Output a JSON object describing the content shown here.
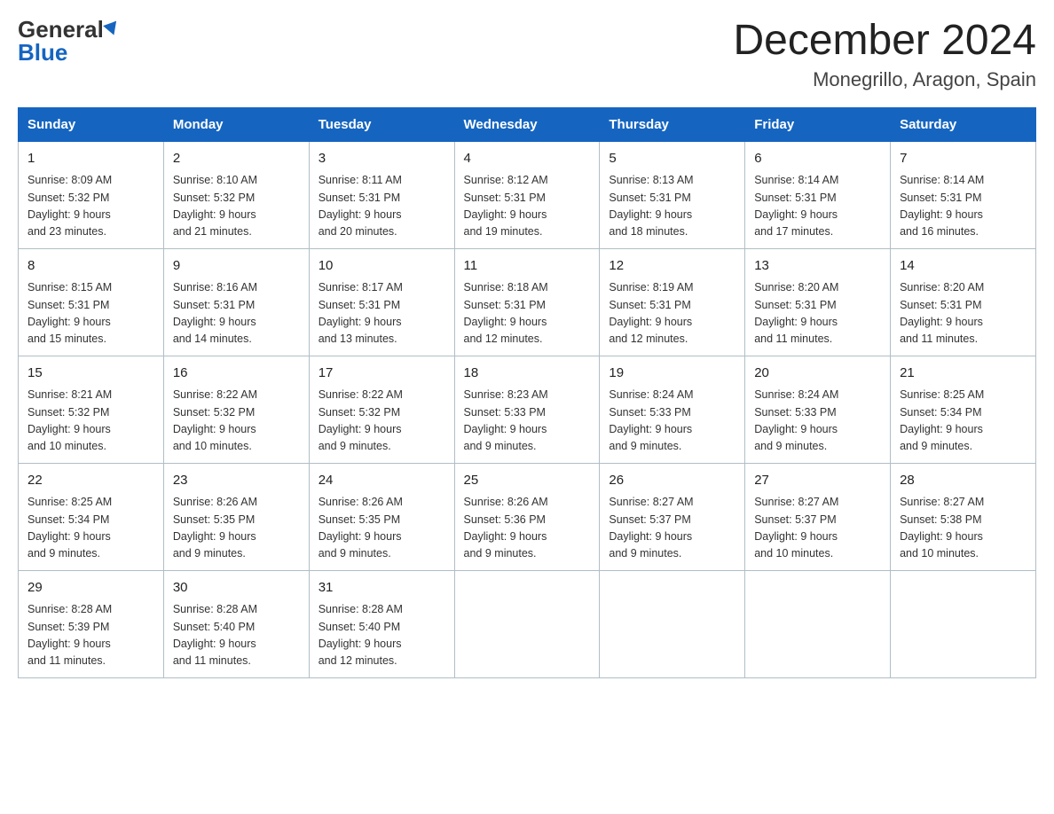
{
  "header": {
    "logo_general": "General",
    "logo_blue": "Blue",
    "title": "December 2024",
    "subtitle": "Monegrillo, Aragon, Spain"
  },
  "days_of_week": [
    "Sunday",
    "Monday",
    "Tuesday",
    "Wednesday",
    "Thursday",
    "Friday",
    "Saturday"
  ],
  "weeks": [
    [
      {
        "day": "1",
        "sunrise": "8:09 AM",
        "sunset": "5:32 PM",
        "daylight": "9 hours and 23 minutes."
      },
      {
        "day": "2",
        "sunrise": "8:10 AM",
        "sunset": "5:32 PM",
        "daylight": "9 hours and 21 minutes."
      },
      {
        "day": "3",
        "sunrise": "8:11 AM",
        "sunset": "5:31 PM",
        "daylight": "9 hours and 20 minutes."
      },
      {
        "day": "4",
        "sunrise": "8:12 AM",
        "sunset": "5:31 PM",
        "daylight": "9 hours and 19 minutes."
      },
      {
        "day": "5",
        "sunrise": "8:13 AM",
        "sunset": "5:31 PM",
        "daylight": "9 hours and 18 minutes."
      },
      {
        "day": "6",
        "sunrise": "8:14 AM",
        "sunset": "5:31 PM",
        "daylight": "9 hours and 17 minutes."
      },
      {
        "day": "7",
        "sunrise": "8:14 AM",
        "sunset": "5:31 PM",
        "daylight": "9 hours and 16 minutes."
      }
    ],
    [
      {
        "day": "8",
        "sunrise": "8:15 AM",
        "sunset": "5:31 PM",
        "daylight": "9 hours and 15 minutes."
      },
      {
        "day": "9",
        "sunrise": "8:16 AM",
        "sunset": "5:31 PM",
        "daylight": "9 hours and 14 minutes."
      },
      {
        "day": "10",
        "sunrise": "8:17 AM",
        "sunset": "5:31 PM",
        "daylight": "9 hours and 13 minutes."
      },
      {
        "day": "11",
        "sunrise": "8:18 AM",
        "sunset": "5:31 PM",
        "daylight": "9 hours and 12 minutes."
      },
      {
        "day": "12",
        "sunrise": "8:19 AM",
        "sunset": "5:31 PM",
        "daylight": "9 hours and 12 minutes."
      },
      {
        "day": "13",
        "sunrise": "8:20 AM",
        "sunset": "5:31 PM",
        "daylight": "9 hours and 11 minutes."
      },
      {
        "day": "14",
        "sunrise": "8:20 AM",
        "sunset": "5:31 PM",
        "daylight": "9 hours and 11 minutes."
      }
    ],
    [
      {
        "day": "15",
        "sunrise": "8:21 AM",
        "sunset": "5:32 PM",
        "daylight": "9 hours and 10 minutes."
      },
      {
        "day": "16",
        "sunrise": "8:22 AM",
        "sunset": "5:32 PM",
        "daylight": "9 hours and 10 minutes."
      },
      {
        "day": "17",
        "sunrise": "8:22 AM",
        "sunset": "5:32 PM",
        "daylight": "9 hours and 9 minutes."
      },
      {
        "day": "18",
        "sunrise": "8:23 AM",
        "sunset": "5:33 PM",
        "daylight": "9 hours and 9 minutes."
      },
      {
        "day": "19",
        "sunrise": "8:24 AM",
        "sunset": "5:33 PM",
        "daylight": "9 hours and 9 minutes."
      },
      {
        "day": "20",
        "sunrise": "8:24 AM",
        "sunset": "5:33 PM",
        "daylight": "9 hours and 9 minutes."
      },
      {
        "day": "21",
        "sunrise": "8:25 AM",
        "sunset": "5:34 PM",
        "daylight": "9 hours and 9 minutes."
      }
    ],
    [
      {
        "day": "22",
        "sunrise": "8:25 AM",
        "sunset": "5:34 PM",
        "daylight": "9 hours and 9 minutes."
      },
      {
        "day": "23",
        "sunrise": "8:26 AM",
        "sunset": "5:35 PM",
        "daylight": "9 hours and 9 minutes."
      },
      {
        "day": "24",
        "sunrise": "8:26 AM",
        "sunset": "5:35 PM",
        "daylight": "9 hours and 9 minutes."
      },
      {
        "day": "25",
        "sunrise": "8:26 AM",
        "sunset": "5:36 PM",
        "daylight": "9 hours and 9 minutes."
      },
      {
        "day": "26",
        "sunrise": "8:27 AM",
        "sunset": "5:37 PM",
        "daylight": "9 hours and 9 minutes."
      },
      {
        "day": "27",
        "sunrise": "8:27 AM",
        "sunset": "5:37 PM",
        "daylight": "9 hours and 10 minutes."
      },
      {
        "day": "28",
        "sunrise": "8:27 AM",
        "sunset": "5:38 PM",
        "daylight": "9 hours and 10 minutes."
      }
    ],
    [
      {
        "day": "29",
        "sunrise": "8:28 AM",
        "sunset": "5:39 PM",
        "daylight": "9 hours and 11 minutes."
      },
      {
        "day": "30",
        "sunrise": "8:28 AM",
        "sunset": "5:40 PM",
        "daylight": "9 hours and 11 minutes."
      },
      {
        "day": "31",
        "sunrise": "8:28 AM",
        "sunset": "5:40 PM",
        "daylight": "9 hours and 12 minutes."
      },
      null,
      null,
      null,
      null
    ]
  ],
  "labels": {
    "sunrise": "Sunrise:",
    "sunset": "Sunset:",
    "daylight": "Daylight:"
  }
}
